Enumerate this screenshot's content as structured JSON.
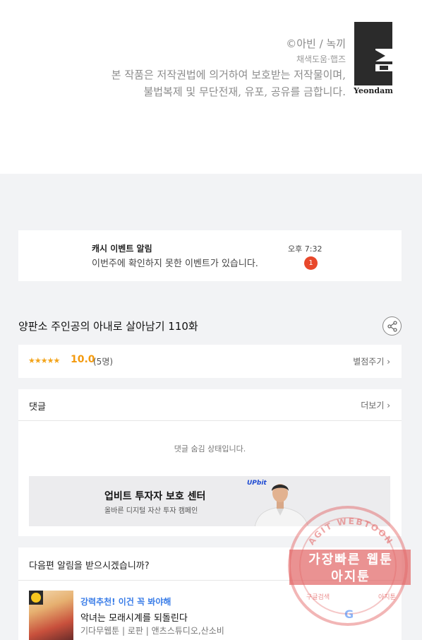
{
  "copyright": {
    "author": "©아빈 / 녹끼",
    "helper": "채색도움·햅즈",
    "notice_line1": "본 작품은 저작권법에 의거하여 보호받는 저작물이며,",
    "notice_line2": "불법복제 및 무단전재, 유포, 공유를 금합니다.",
    "logo_text": "Yeondam"
  },
  "notification": {
    "title": "캐시 이벤트 알림",
    "message": "이번주에 확인하지 못한 이벤트가 있습니다.",
    "time": "오후 7:32",
    "badge_count": "1"
  },
  "episode": {
    "title": "양판소 주인공의 아내로 살아남기 110화"
  },
  "rating": {
    "stars": "★★★★★",
    "score": "10.0",
    "count": "(5명)",
    "rate_button": "별점주기 ›"
  },
  "comments": {
    "header": "댓글",
    "more": "더보기 ›",
    "hidden_message": "댓글 숨김 상태입니다."
  },
  "ad": {
    "title": "업비트 투자자 보호 센터",
    "subtitle": "올바른 디지털 자산 투자 캠페인",
    "brand": "UPbit"
  },
  "subscribe": {
    "question": "다음편 알림을 받으시겠습니까?"
  },
  "recommendation": {
    "tag": "강력추천! 이건 꼭 봐야해",
    "title": "악녀는 모래시계를 되돌린다",
    "meta": "기다무웹툰 | 로판 | 앤츠스튜디오,산소비"
  },
  "watermark": {
    "arc_text": "AGIT WEBTOON",
    "line1": "가장빠른 웹툰",
    "line2": "아지툰",
    "bottom_left": "구글검색",
    "bottom_right": "아지툰",
    "g": "G"
  },
  "colors": {
    "accent_orange": "#f39a0e",
    "badge_red": "#e8482b",
    "link_blue": "#3a7de8",
    "stamp_red": "#e25e5e"
  }
}
